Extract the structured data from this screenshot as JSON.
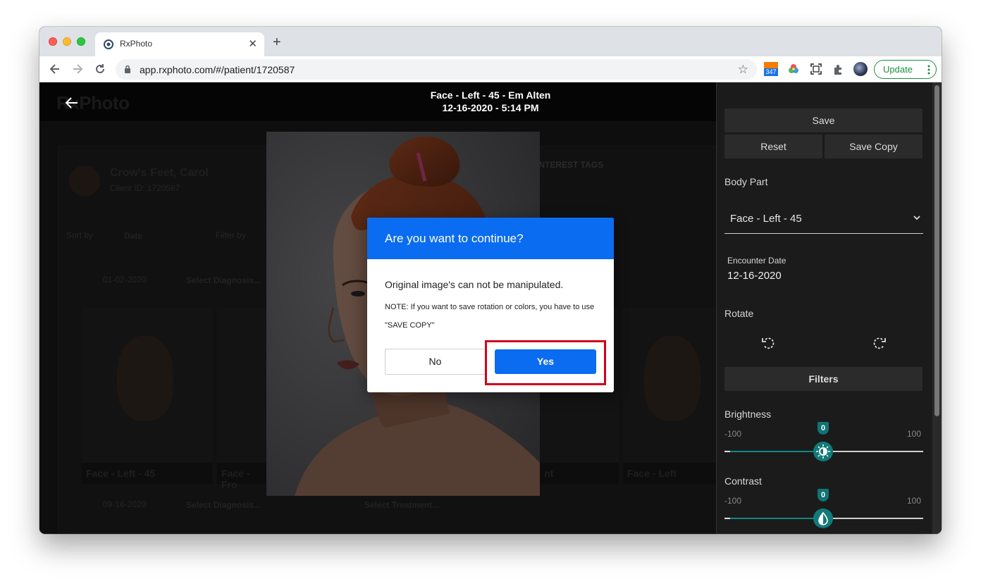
{
  "browser": {
    "tab_title": "RxPhoto",
    "url": "app.rxphoto.com/#/patient/1720587",
    "new_tab": "+",
    "tab_close": "✕",
    "extension_badge": "347",
    "update_label": "Update"
  },
  "app": {
    "brand": "RxPhoto",
    "viewer_title_line1": "Face - Left - 45 - Em Alten",
    "viewer_title_line2": "12-16-2020 - 5:14 PM"
  },
  "background": {
    "patient_name": "Crow's Feet, Carol",
    "client_id": "Client ID: 1720587",
    "sort_by": "Sort by",
    "sort_value": "Date",
    "filter_by": "Filter by",
    "interest_tags": "INTEREST TAGS",
    "date1": "01-02-2020",
    "select_diagnosis": "Select Diagnosis...",
    "date2": "09-16-2020",
    "select_treatment": "Select Treatment...",
    "thumb_labels": [
      "Face - Left - 45",
      "Face - Fro",
      "nt",
      "Face - Left"
    ]
  },
  "panel": {
    "save": "Save",
    "reset": "Reset",
    "save_copy": "Save Copy",
    "body_part_label": "Body Part",
    "body_part_value": "Face - Left - 45",
    "encounter_label": "Encounter Date",
    "encounter_value": "12-16-2020",
    "rotate_label": "Rotate",
    "filters": "Filters",
    "brightness_label": "Brightness",
    "brightness_value": "0",
    "contrast_label": "Contrast",
    "contrast_value": "0",
    "slider_min": "-100",
    "slider_max": "100"
  },
  "modal": {
    "title": "Are you want to continue?",
    "message": "Original image's can not be manipulated.",
    "note": "NOTE: If you want to save rotation or colors, you have to use \"SAVE COPY\"",
    "no": "No",
    "yes": "Yes"
  },
  "colors": {
    "modal_header": "#0a6cf0",
    "highlight": "#d0021b",
    "slider_accent": "#0f8a87",
    "update_green": "#1e8e3e"
  }
}
